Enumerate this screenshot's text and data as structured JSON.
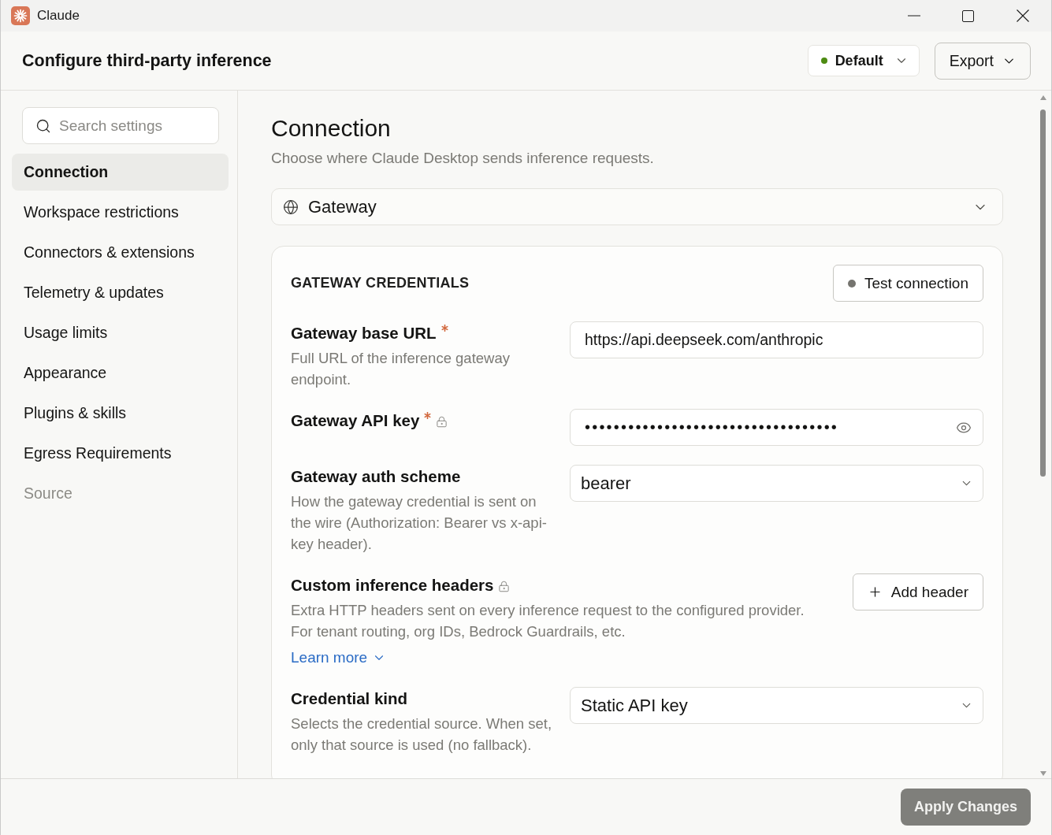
{
  "window": {
    "title": "Claude"
  },
  "header": {
    "title": "Configure third-party inference",
    "profile": {
      "value": "Default",
      "active": true
    },
    "export_button": {
      "label": "Export"
    }
  },
  "sidebar": {
    "search": {
      "placeholder": "Search settings"
    },
    "items": [
      {
        "label": "Connection",
        "selected": true,
        "disabled": false
      },
      {
        "label": "Workspace restrictions",
        "selected": false,
        "disabled": false
      },
      {
        "label": "Connectors & extensions",
        "selected": false,
        "disabled": false
      },
      {
        "label": "Telemetry & updates",
        "selected": false,
        "disabled": false
      },
      {
        "label": "Usage limits",
        "selected": false,
        "disabled": false
      },
      {
        "label": "Appearance",
        "selected": false,
        "disabled": false
      },
      {
        "label": "Plugins & skills",
        "selected": false,
        "disabled": false
      },
      {
        "label": "Egress Requirements",
        "selected": false,
        "disabled": false
      },
      {
        "label": "Source",
        "selected": false,
        "disabled": true
      }
    ]
  },
  "content": {
    "title": "Connection",
    "subtitle": "Choose where Claude Desktop sends inference requests.",
    "provider_select": {
      "value": "Gateway"
    },
    "card": {
      "title": "GATEWAY CREDENTIALS",
      "test_button": {
        "label": "Test connection",
        "active": false
      },
      "fields": [
        {
          "kind": "text",
          "label": "Gateway base URL",
          "required": true,
          "locked": false,
          "description": "Full URL of the inference gateway endpoint.",
          "value": "https://api.deepseek.com/anthropic"
        },
        {
          "kind": "password",
          "label": "Gateway API key",
          "required": true,
          "locked": true,
          "value": "•••••••••••••••••••••••••••••••••••"
        },
        {
          "kind": "select",
          "label": "Gateway auth scheme",
          "required": false,
          "locked": false,
          "description": "How the gateway credential is sent on the wire (Authorization: Bearer vs x-api-key header).",
          "value": "bearer"
        },
        {
          "kind": "headers",
          "label": "Custom inference headers",
          "required": false,
          "locked": true,
          "description": "Extra HTTP headers sent on every inference request to the configured provider. For tenant routing, org IDs, Bedrock Guardrails, etc.",
          "link": {
            "label": "Learn more",
            "expanded": false
          },
          "button": "Add header"
        },
        {
          "kind": "select",
          "label": "Credential kind",
          "required": false,
          "locked": false,
          "description": "Selects the credential source. When set, only that source is used (no fallback).",
          "value": "Static API key"
        }
      ]
    }
  },
  "footer": {
    "apply_button": {
      "label": "Apply Changes",
      "disabled": true
    }
  }
}
